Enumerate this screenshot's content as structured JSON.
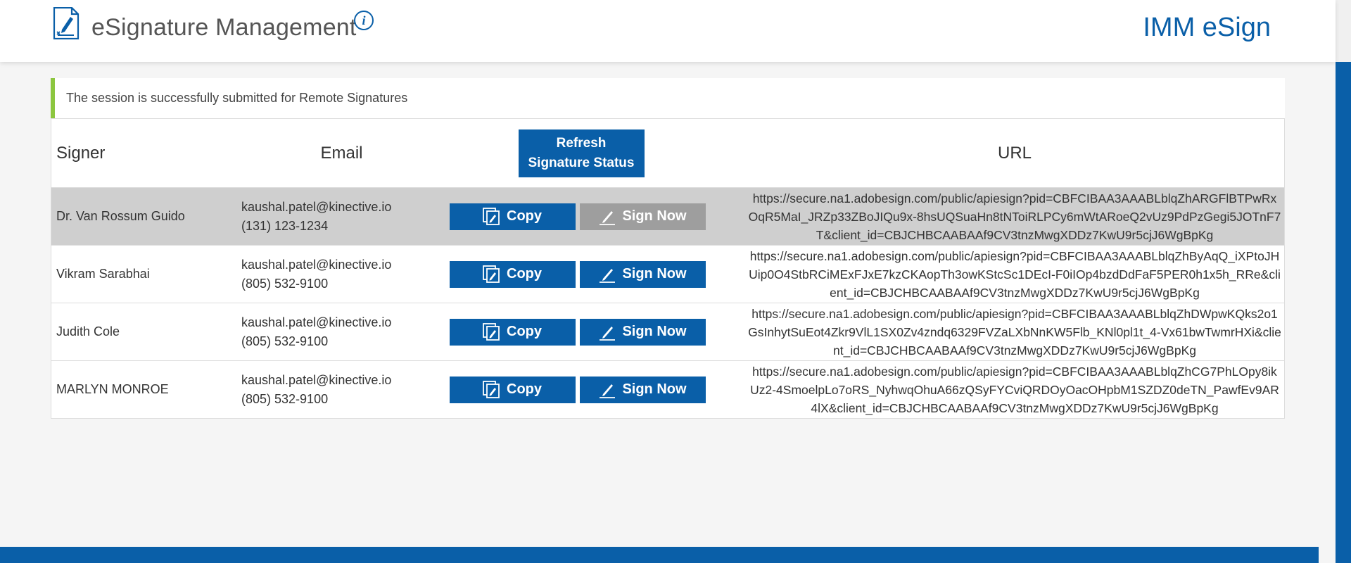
{
  "header": {
    "title": "eSignature Management",
    "brand": "IMM eSign",
    "info_glyph": "i",
    "icons": {
      "document": "signature-document-icon",
      "info": "info-icon"
    }
  },
  "alert": {
    "message": "The session is successfully submitted for Remote Signatures",
    "accent_color": "#8cc63f"
  },
  "table": {
    "columns": {
      "signer": "Signer",
      "email": "Email",
      "refresh": "Refresh Signature Status",
      "url": "URL"
    },
    "refresh_lines": [
      "Refresh",
      "Signature Status"
    ],
    "copy_label": "Copy",
    "sign_label": "Sign Now",
    "rows": [
      {
        "signer": "Dr. Van Rossum Guido",
        "email": "kaushal.patel@kinective.io",
        "phone": "(131) 123-1234",
        "url": "https://secure.na1.adobesign.com/public/apiesign?pid=CBFCIBAA3AAABLblqZhARGFlBTPwRxOqR5MaI_JRZp33ZBoJIQu9x-8hsUQSuaHn8tNToiRLPCy6mWtARoeQ2vUz9PdPzGegi5JOTnF7T&client_id=CBJCHBCAABAAf9CV3tnzMwgXDDz7KwU9r5cjJ6WgBpKg",
        "sign_disabled": true
      },
      {
        "signer": "Vikram Sarabhai",
        "email": "kaushal.patel@kinective.io",
        "phone": "(805) 532-9100",
        "url": "https://secure.na1.adobesign.com/public/apiesign?pid=CBFCIBAA3AAABLblqZhByAqQ_iXPtoJHUip0O4StbRCiMExFJxE7kzCKAopTh3owKStcSc1DEcI-F0iIOp4bzdDdFaF5PER0h1x5h_RRe&client_id=CBJCHBCAABAAf9CV3tnzMwgXDDz7KwU9r5cjJ6WgBpKg",
        "sign_disabled": false
      },
      {
        "signer": "Judith Cole",
        "email": "kaushal.patel@kinective.io",
        "phone": "(805) 532-9100",
        "url": "https://secure.na1.adobesign.com/public/apiesign?pid=CBFCIBAA3AAABLblqZhDWpwKQks2o1GsInhytSuEot4Zkr9VlL1SX0Zv4zndq6329FVZaLXbNnKW5Flb_KNl0pl1t_4-Vx61bwTwmrHXi&client_id=CBJCHBCAABAAf9CV3tnzMwgXDDz7KwU9r5cjJ6WgBpKg",
        "sign_disabled": false
      },
      {
        "signer": "MARLYN MONROE",
        "email": "kaushal.patel@kinective.io",
        "phone": "(805) 532-9100",
        "url": "https://secure.na1.adobesign.com/public/apiesign?pid=CBFCIBAA3AAABLblqZhCG7PhLOpy8ikUz2-4SmoelpLo7oRS_NyhwqOhuA66zQSyFYCviQRDOyOacOHpbM1SZDZ0deTN_PawfEv9AR4lX&client_id=CBJCHBCAABAAf9CV3tnzMwgXDDz7KwU9r5cjJ6WgBpKg",
        "sign_disabled": false
      }
    ]
  },
  "colors": {
    "primary": "#0a5fa8",
    "disabled": "#9e9e9e",
    "row_highlight": "#cfcfcf"
  }
}
